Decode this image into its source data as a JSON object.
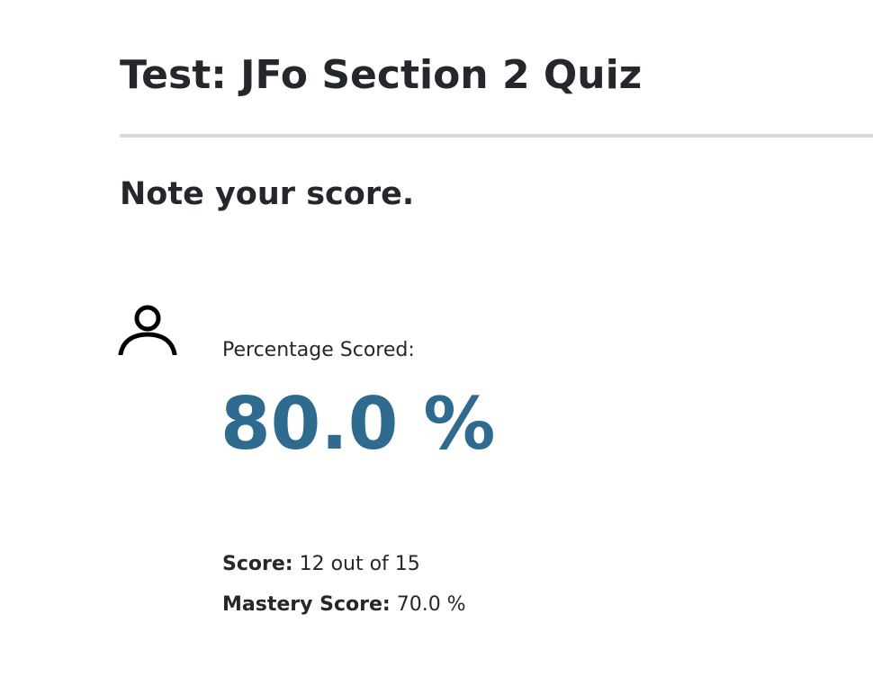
{
  "page": {
    "title": "Test: JFo Section 2 Quiz",
    "subheading": "Note your score."
  },
  "result": {
    "icon": "user-icon",
    "percentage_label": "Percentage Scored:",
    "percentage_value": "80.0 %",
    "score_label": "Score:",
    "score_value": "12 out of 15",
    "mastery_label": "Mastery Score:",
    "mastery_value": "70.0 %"
  },
  "colors": {
    "percentage_text": "#2e6b8e",
    "heading_text": "#24272c",
    "divider": "#d9d9d9"
  }
}
